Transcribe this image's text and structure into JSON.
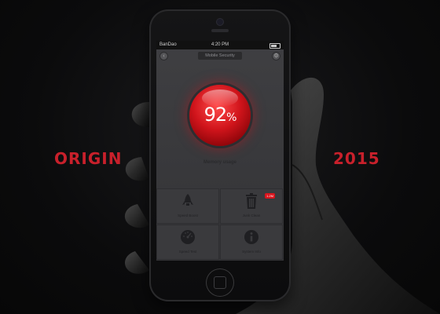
{
  "side": {
    "left": "ORIGIN",
    "right": "2015"
  },
  "status": {
    "carrier": "BanDao",
    "time": "4:20 PM"
  },
  "app": {
    "title": "Mobile Security"
  },
  "memory": {
    "value": "92",
    "unit": "%",
    "label": "Memory usage"
  },
  "tiles": [
    {
      "label": "Speed Boost",
      "icon": "rocket-icon"
    },
    {
      "label": "Junk Clean",
      "icon": "trash-icon",
      "badge": "1.2M"
    },
    {
      "label": "Speed Test",
      "icon": "speedometer-icon"
    },
    {
      "label": "System Info",
      "icon": "info-icon"
    }
  ],
  "colors": {
    "accent": "#c8202b",
    "ball": "#d0141b",
    "background": "#0b0b0c"
  }
}
